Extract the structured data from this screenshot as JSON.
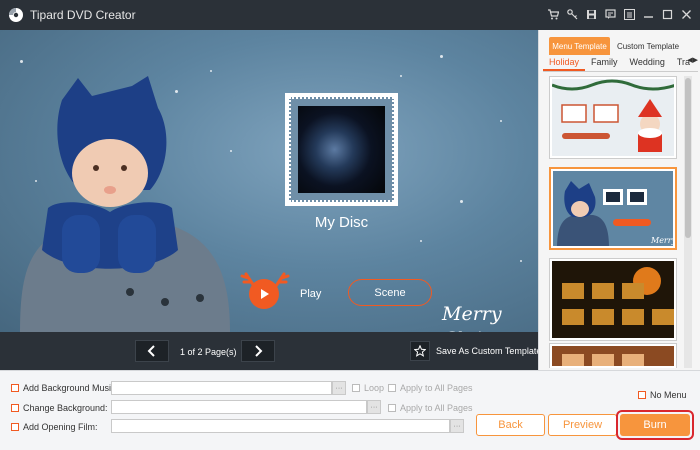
{
  "window": {
    "title": "Tipard DVD Creator",
    "icons": [
      "cart-icon",
      "key-icon",
      "save-icon",
      "feedback-icon",
      "menu-icon",
      "minimize-icon",
      "maximize-icon",
      "close-icon"
    ]
  },
  "preview": {
    "disc_title": "My Disc",
    "play_label": "Play",
    "scene_label": "Scene"
  },
  "pagination": {
    "label": "1 of 2 Page(s)",
    "save_template_label": "Save As Custom Template"
  },
  "templates": {
    "tabs": [
      {
        "label": "Menu Template",
        "active": true
      },
      {
        "label": "Custom Template",
        "active": false
      }
    ],
    "categories": [
      {
        "label": "Holiday",
        "active": true
      },
      {
        "label": "Family",
        "active": false
      },
      {
        "label": "Wedding",
        "active": false
      },
      {
        "label": "Tra",
        "active": false
      }
    ],
    "selected_index": 1
  },
  "options": {
    "background_music": {
      "label": "Add Background Music:",
      "value": ""
    },
    "loop": "Loop",
    "apply_all_1": "Apply to All Pages",
    "change_background": {
      "label": "Change Background:",
      "value": ""
    },
    "apply_all_2": "Apply to All Pages",
    "opening_film": {
      "label": "Add Opening Film:",
      "value": ""
    },
    "browse": "···",
    "no_menu": "No Menu"
  },
  "actions": {
    "back": "Back",
    "preview": "Preview",
    "burn": "Burn"
  },
  "colors": {
    "accent": "#f7953d",
    "highlight": "#d9272e",
    "titlebar": "#2b3138"
  }
}
